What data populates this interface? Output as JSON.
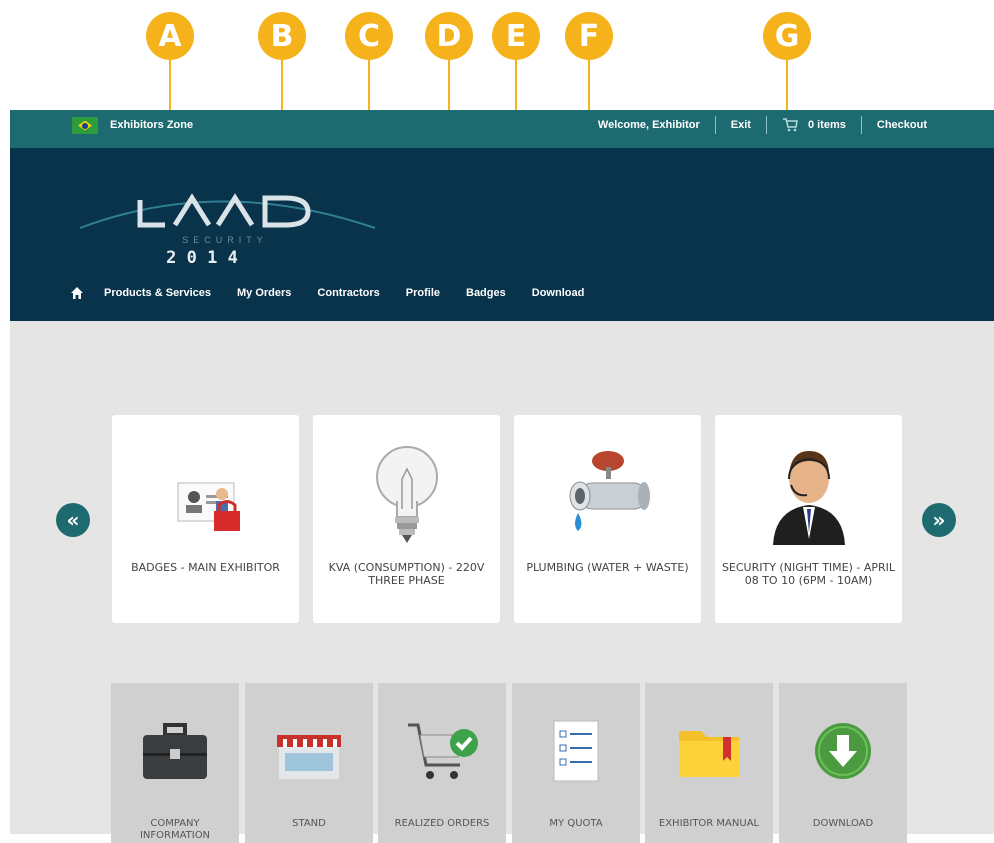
{
  "markers": [
    "A",
    "B",
    "C",
    "D",
    "E",
    "F",
    "G"
  ],
  "topbar": {
    "zone_label": "Exhibitors Zone",
    "welcome": "Welcome, Exhibitor",
    "exit": "Exit",
    "cart_count": "0 items",
    "checkout": "Checkout"
  },
  "logo": {
    "name": "LAAD",
    "sub": "SECURITY",
    "year": "2 0 1 4"
  },
  "nav": [
    "Products & Services",
    "My Orders",
    "Contractors",
    "Profile",
    "Badges",
    "Download"
  ],
  "products": [
    {
      "label": "BADGES - MAIN EXHIBITOR",
      "icon": "badge-icon"
    },
    {
      "label": "KVA (CONSUMPTION) - 220V THREE PHASE",
      "icon": "lightbulb-icon"
    },
    {
      "label": "PLUMBING (WATER + WASTE)",
      "icon": "faucet-icon"
    },
    {
      "label": "SECURITY (NIGHT TIME) - APRIL 08 TO 10 (6PM - 10AM)",
      "icon": "security-guard-icon"
    }
  ],
  "carousel": {
    "prev": "«",
    "next": "»"
  },
  "tiles": [
    {
      "label": "COMPANY INFORMATION",
      "icon": "briefcase-icon"
    },
    {
      "label": "STAND",
      "icon": "store-icon"
    },
    {
      "label": "REALIZED ORDERS",
      "icon": "cart-check-icon"
    },
    {
      "label": "MY QUOTA",
      "icon": "checklist-icon"
    },
    {
      "label": "EXHIBITOR MANUAL",
      "icon": "folder-icon"
    },
    {
      "label": "DOWNLOAD",
      "icon": "download-icon"
    }
  ],
  "colors": {
    "accent": "#f5b21a",
    "topbar": "#1d6b70",
    "header": "#08334a",
    "content_bg": "#e5e5e5"
  }
}
